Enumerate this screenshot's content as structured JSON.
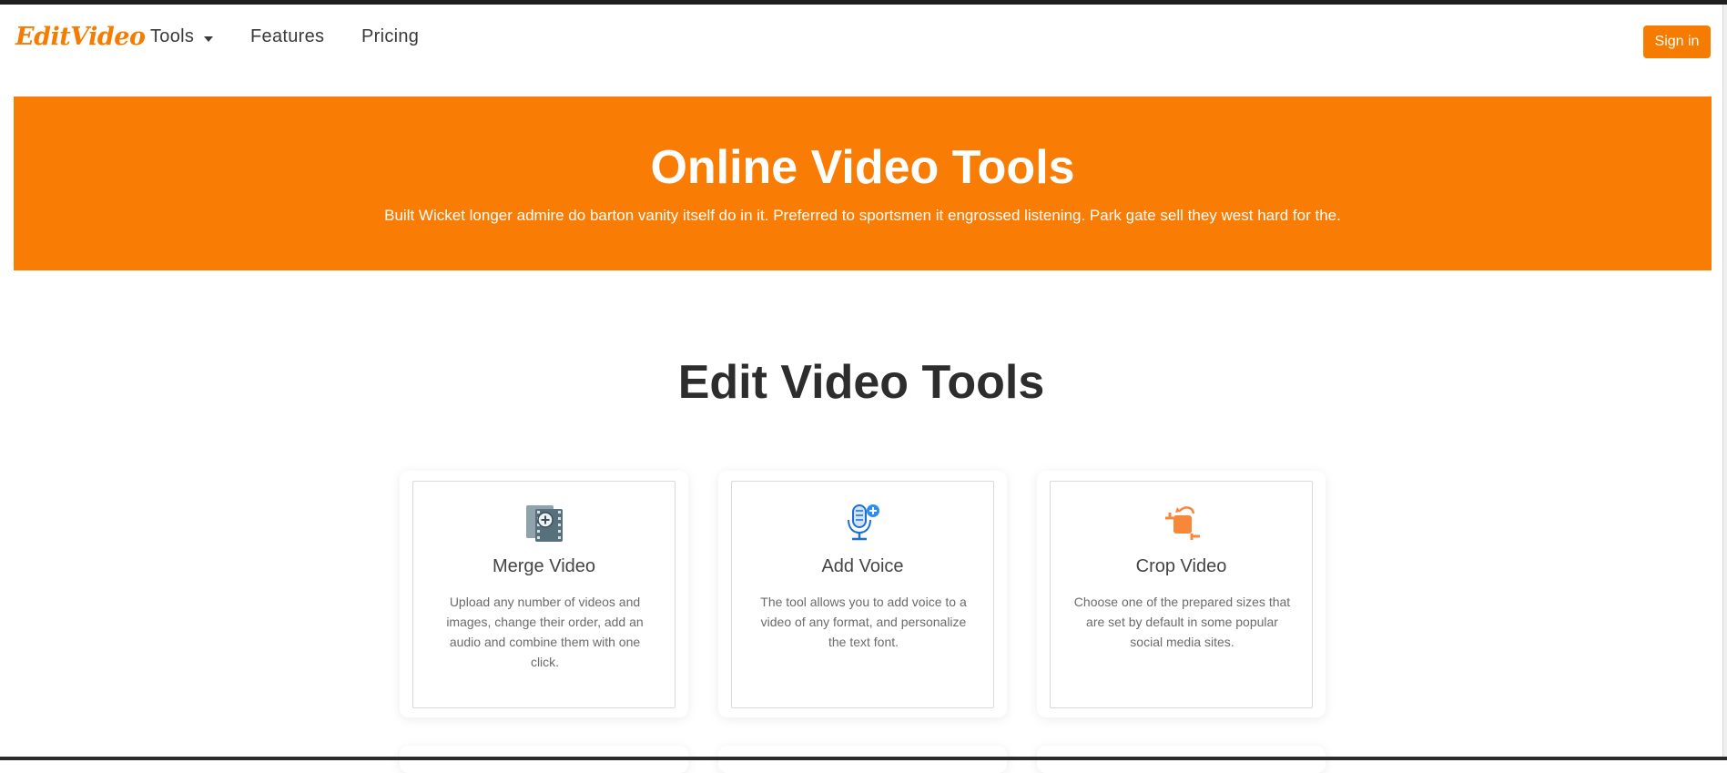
{
  "brand": {
    "logo_text": "EditVideo",
    "accent": "#f97c05"
  },
  "nav": {
    "tools_label": "Tools",
    "features_label": "Features",
    "pricing_label": "Pricing",
    "signin_label": "Sign in"
  },
  "hero": {
    "title": "Online Video Tools",
    "subtitle": "Built Wicket longer admire do barton vanity itself do in it. Preferred to sportsmen it engrossed listening. Park gate sell they west hard for the."
  },
  "section": {
    "title": "Edit Video Tools",
    "cards": [
      {
        "icon": "film-plus-icon",
        "title": "Merge Video",
        "description": "Upload any number of videos and images, change their order, add an audio and combine them with one click."
      },
      {
        "icon": "microphone-plus-icon",
        "title": "Add Voice",
        "description": "The tool allows you to add voice to a video of any format, and personalize the text font."
      },
      {
        "icon": "crop-icon",
        "title": "Crop Video",
        "description": "Choose one of the prepared sizes that are set by default in some popular social media sites."
      }
    ]
  }
}
